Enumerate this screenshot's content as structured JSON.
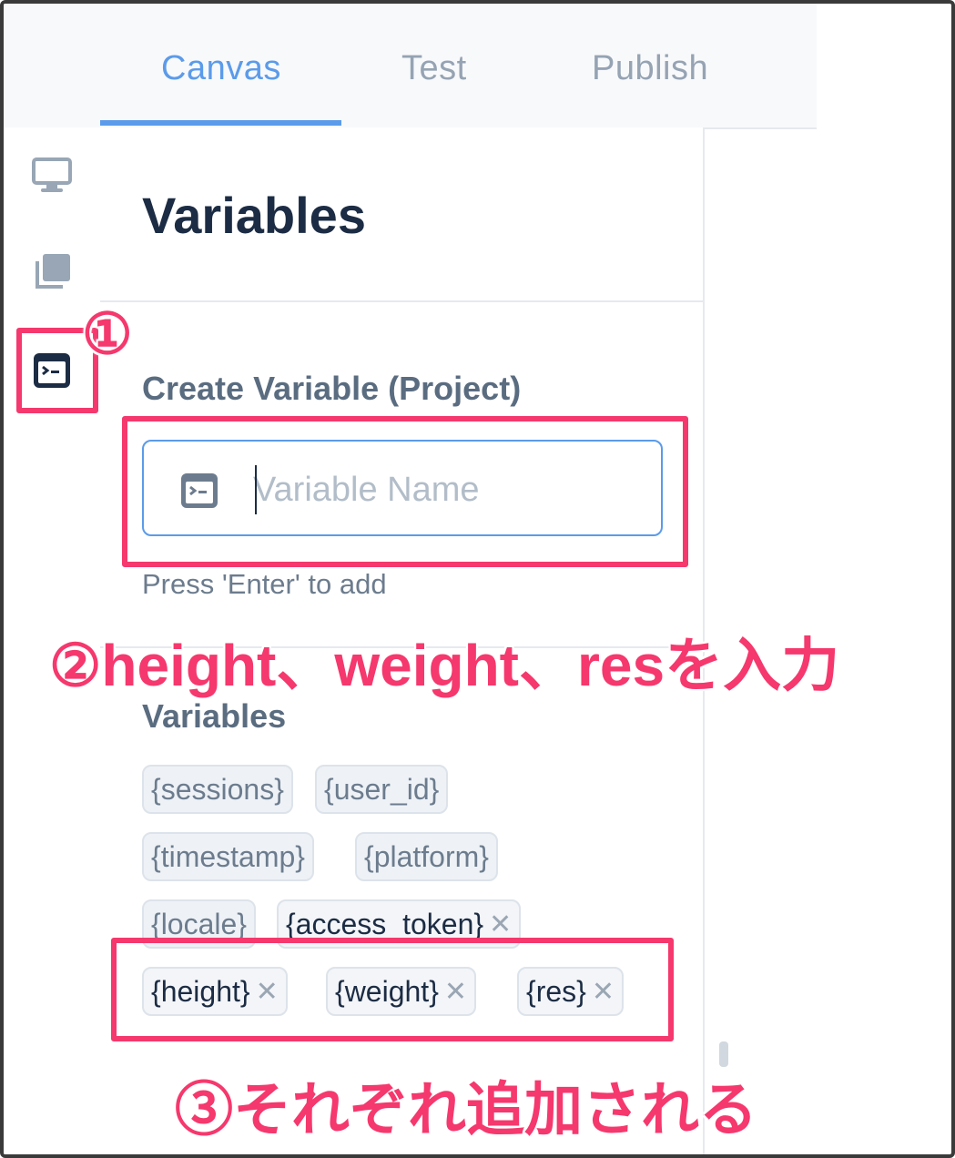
{
  "tabs": [
    {
      "label": "Canvas",
      "active": true
    },
    {
      "label": "Test",
      "active": false
    },
    {
      "label": "Publish",
      "active": false
    }
  ],
  "rail": [
    {
      "icon": "monitor-icon"
    },
    {
      "icon": "stack-icon"
    },
    {
      "icon": "terminal-icon",
      "active": true
    }
  ],
  "panel": {
    "title": "Variables",
    "create_label": "Create Variable (Project)",
    "input_placeholder": "Variable Name",
    "input_value": "",
    "hint": "Press 'Enter' to add",
    "list_label": "Variables",
    "chips": [
      {
        "label": "{sessions}",
        "removable": false
      },
      {
        "label": "{user_id}",
        "removable": false
      },
      {
        "label": "{timestamp}",
        "removable": false
      },
      {
        "label": "{platform}",
        "removable": false
      },
      {
        "label": "{locale}",
        "removable": false
      },
      {
        "label": "{access_token}",
        "removable": true
      },
      {
        "label": "{height}",
        "removable": true
      },
      {
        "label": "{weight}",
        "removable": true
      },
      {
        "label": "{res}",
        "removable": true
      }
    ],
    "remove_glyph": "✕"
  },
  "annotations": {
    "step1": "①",
    "step2": "②height、weight、resを入力",
    "step3": "③それぞれ追加される"
  },
  "colors": {
    "accent": "#5b9bea",
    "highlight": "#f5386d",
    "title": "#1c2c44"
  }
}
